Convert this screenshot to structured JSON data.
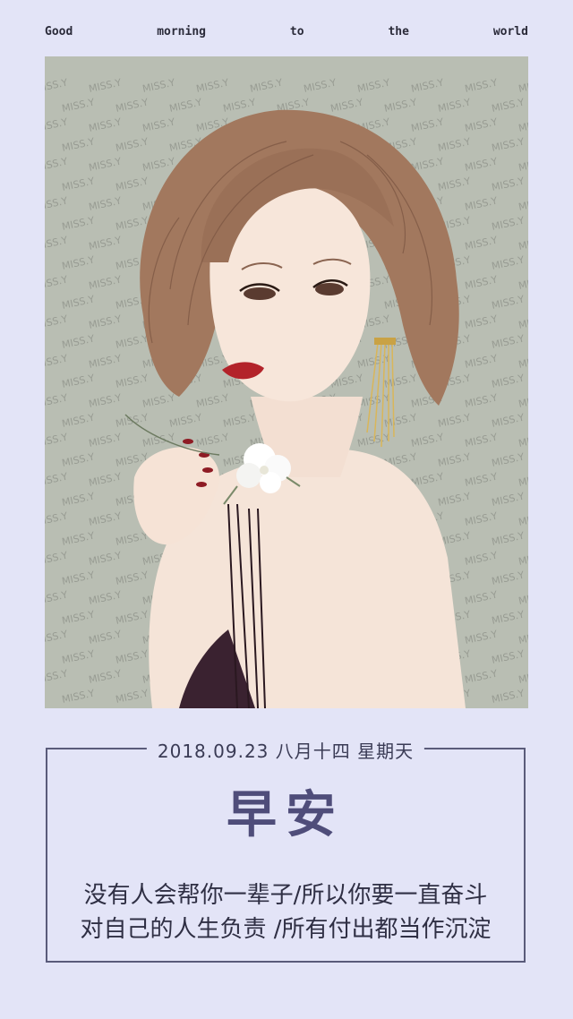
{
  "header": {
    "tagline_words": [
      "Good",
      "morning",
      "to",
      "the",
      "world"
    ]
  },
  "illustration": {
    "watermark_text": "MISS.Y",
    "colors": {
      "background": "#b9beb3",
      "hair": "#a2785e",
      "skin": "#f7e6da",
      "lips": "#b3232a",
      "dress": "#3a2230",
      "flower": "#ffffff",
      "earring": "#d9b65a"
    }
  },
  "card": {
    "date": "2018.09.23 八月十四 星期天",
    "title": "早安",
    "line1": "没有人会帮你一辈子/所以你要一直奋斗",
    "line2": "对自己的人生负责 /所有付出都当作沉淀",
    "border_color": "#5a5b7a",
    "title_color": "#4f4d7a"
  }
}
